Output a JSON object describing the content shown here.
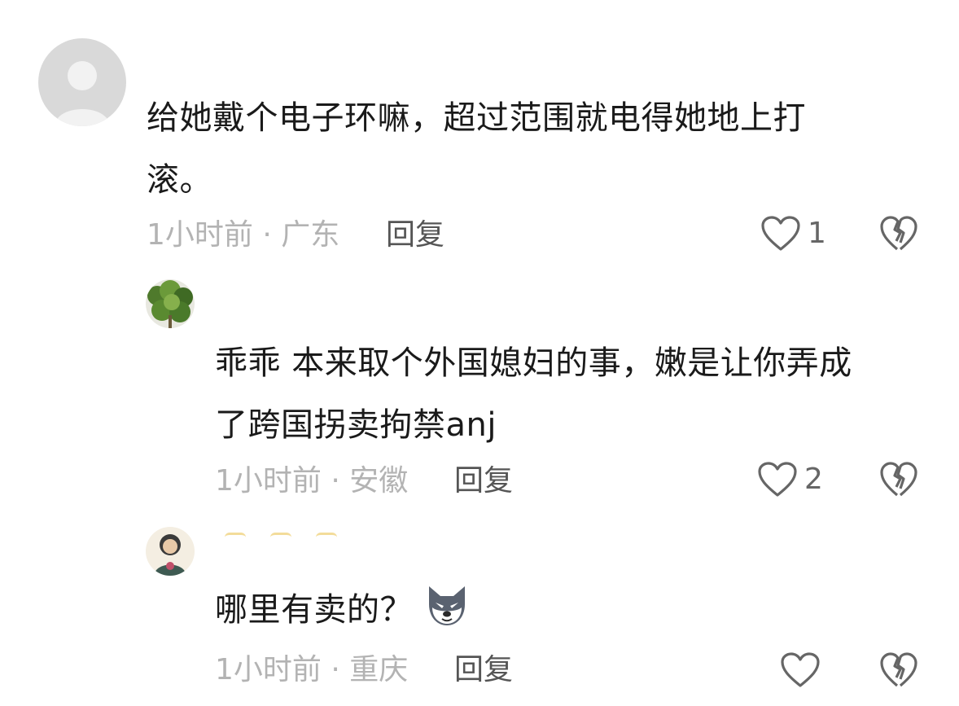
{
  "comments": [
    {
      "text": "给她戴个电子环嘛，超过范围就电得她地上打\n滚。",
      "meta": "1小时前 · 广东",
      "reply_label": "回复",
      "likes": "1",
      "avatar": "default-avatar"
    },
    {
      "text": "乖乖 本来取个外国媳妇的事，嫩是让你弄成\n了跨国拐卖拘禁anj",
      "meta": "1小时前 · 安徽",
      "reply_label": "回复",
      "likes": "2",
      "avatar": "plant-avatar"
    },
    {
      "text": "哪里有卖的？",
      "meta": "1小时前 · 重庆",
      "reply_label": "回复",
      "likes": "",
      "avatar": "person-avatar",
      "emoji": "wolf-emoji"
    }
  ],
  "colors": {
    "text": "#1a1a1a",
    "meta": "#b3b3b3",
    "reply": "#555555",
    "icon": "#666666"
  }
}
